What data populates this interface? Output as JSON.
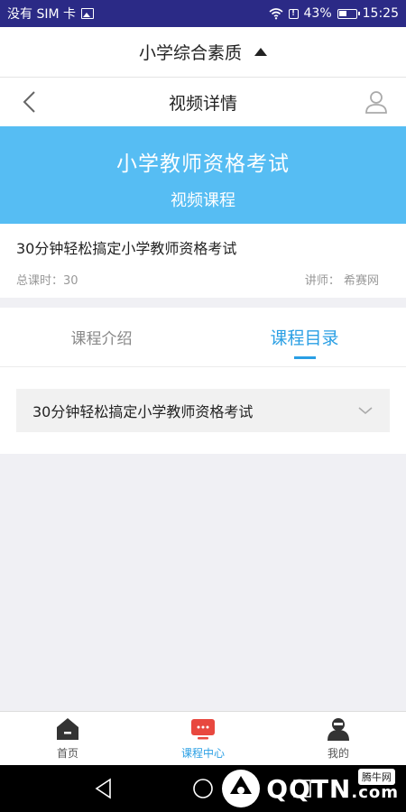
{
  "status_bar": {
    "carrier": "没有 SIM 卡",
    "battery": "43%",
    "time": "15:25"
  },
  "category": {
    "title": "小学综合素质",
    "toggle_icon": "triangle-up-icon"
  },
  "nav": {
    "title": "视频详情",
    "back_icon": "chevron-left-icon",
    "user_icon": "user-icon"
  },
  "banner": {
    "title": "小学教师资格考试",
    "subtitle": "视频课程",
    "color": "#56bdf3"
  },
  "course": {
    "name": "30分钟轻松搞定小学教师资格考试",
    "total_lessons": "总课时：30",
    "lecturer": "讲师：  希赛网"
  },
  "tabs": [
    {
      "label": "课程介绍",
      "active": false
    },
    {
      "label": "课程目录",
      "active": true
    }
  ],
  "catalog": {
    "items": [
      {
        "label": "30分钟轻松搞定小学教师资格考试",
        "icon": "chevron-down-icon"
      }
    ]
  },
  "bottom_tabs": [
    {
      "label": "首页",
      "icon": "home-icon",
      "active": false
    },
    {
      "label": "课程中心",
      "icon": "tv-icon",
      "active": true
    },
    {
      "label": "我的",
      "icon": "profile-icon",
      "active": false
    }
  ],
  "accent_color": "#2a9fe4",
  "watermark": {
    "text": "QQTN",
    "suffix": ".com",
    "badge": "腾牛网"
  }
}
